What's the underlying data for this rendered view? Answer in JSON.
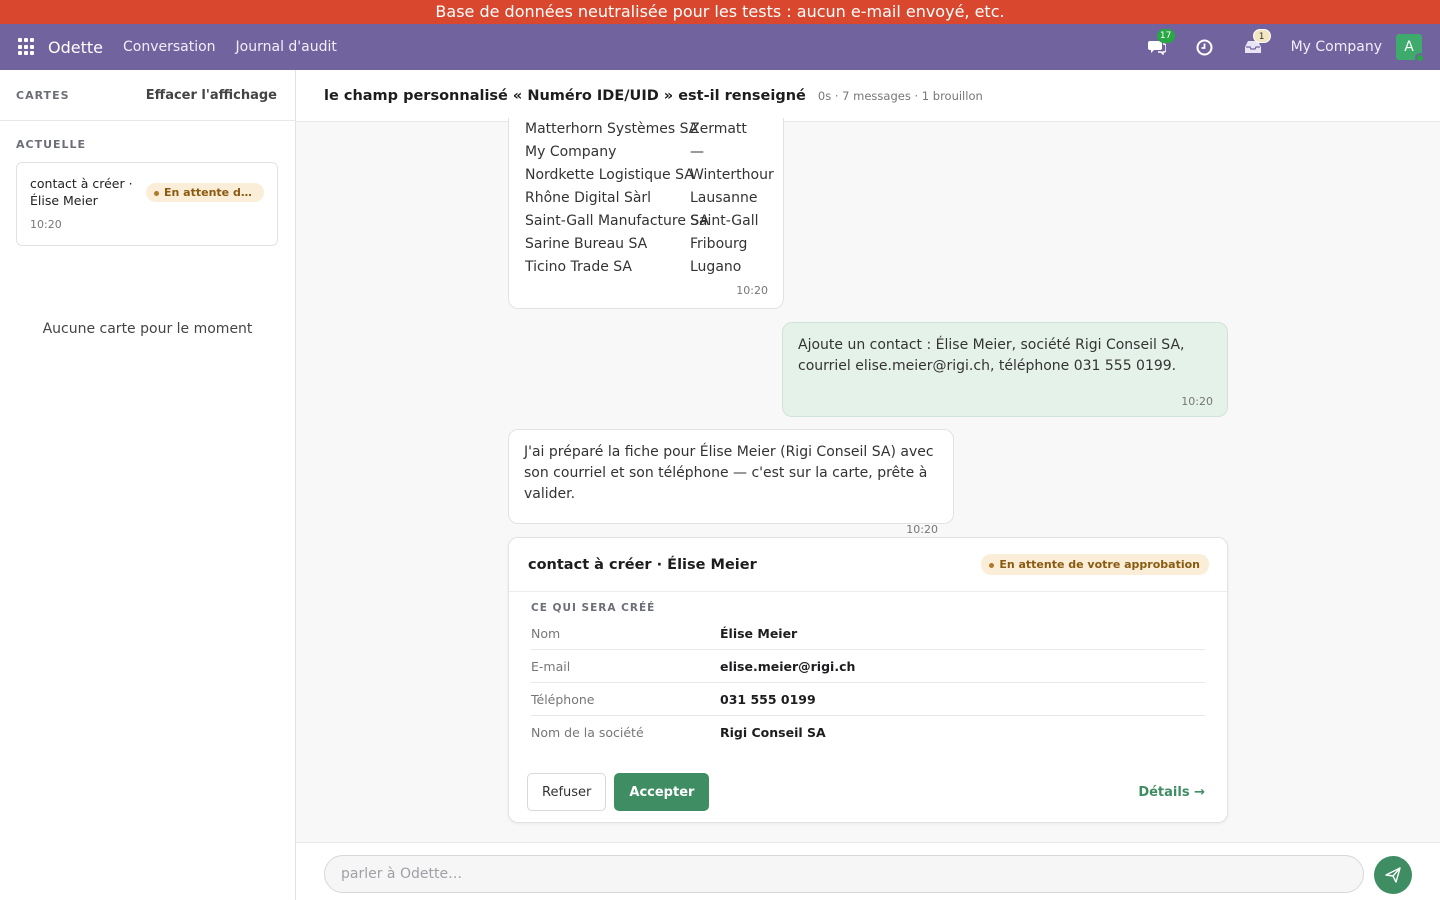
{
  "banner": {
    "text": "Base de données neutralisée pour les tests : aucun e-mail envoyé, etc."
  },
  "topbar": {
    "app_name": "Odette",
    "nav": [
      "Conversation",
      "Journal d'audit"
    ],
    "chat_badge": "17",
    "activity_badge": "1",
    "company": "My Company",
    "avatar_letter": "A",
    "colors": {
      "bar": "#71639e",
      "banner": "#d9472e",
      "accent": "#3f8e63"
    }
  },
  "sidebar": {
    "title": "CARTES",
    "clear_label": "Effacer l'affichage",
    "current_label": "ACTUELLE",
    "card": {
      "title": "contact à créer · Élise Meier",
      "status": "En attente de votre approbation",
      "time": "10:20"
    },
    "empty_text": "Aucune carte pour le moment"
  },
  "conversation": {
    "title": "le champ personnalisé « Numéro IDE/UID » est-il renseigné",
    "meta": "0s · 7 messages · 1 brouillon"
  },
  "messages": {
    "table": {
      "rows": [
        {
          "company": "Matterhorn Systèmes SA",
          "city": "Zermatt"
        },
        {
          "company": "My Company",
          "city": "—"
        },
        {
          "company": "Nordkette Logistique SA",
          "city": "Winterthour"
        },
        {
          "company": "Rhône Digital Sàrl",
          "city": "Lausanne"
        },
        {
          "company": "Saint-Gall Manufacture SA",
          "city": "Saint-Gall"
        },
        {
          "company": "Sarine Bureau SA",
          "city": "Fribourg"
        },
        {
          "company": "Ticino Trade SA",
          "city": "Lugano"
        }
      ],
      "time": "10:20"
    },
    "user": {
      "text": "Ajoute un contact : Élise Meier, société Rigi Conseil SA, courriel elise.meier@rigi.ch, téléphone 031 555 0199.",
      "time": "10:20"
    },
    "bot": {
      "text": "J'ai préparé la fiche pour Élise Meier (Rigi Conseil SA) avec son courriel et son téléphone — c'est sur la carte, prête à valider.",
      "time": "10:20"
    }
  },
  "approval": {
    "title": "contact à créer · Élise Meier",
    "status": "En attente de votre approbation",
    "section": "CE QUI SERA CRÉÉ",
    "fields": [
      {
        "label": "Nom",
        "value": "Élise Meier"
      },
      {
        "label": "E-mail",
        "value": "elise.meier@rigi.ch"
      },
      {
        "label": "Téléphone",
        "value": "031 555 0199"
      },
      {
        "label": "Nom de la société",
        "value": "Rigi Conseil SA"
      }
    ],
    "refuse_label": "Refuser",
    "accept_label": "Accepter",
    "details_label": "Détails →"
  },
  "composer": {
    "placeholder": "parler à Odette…",
    "value": ""
  }
}
